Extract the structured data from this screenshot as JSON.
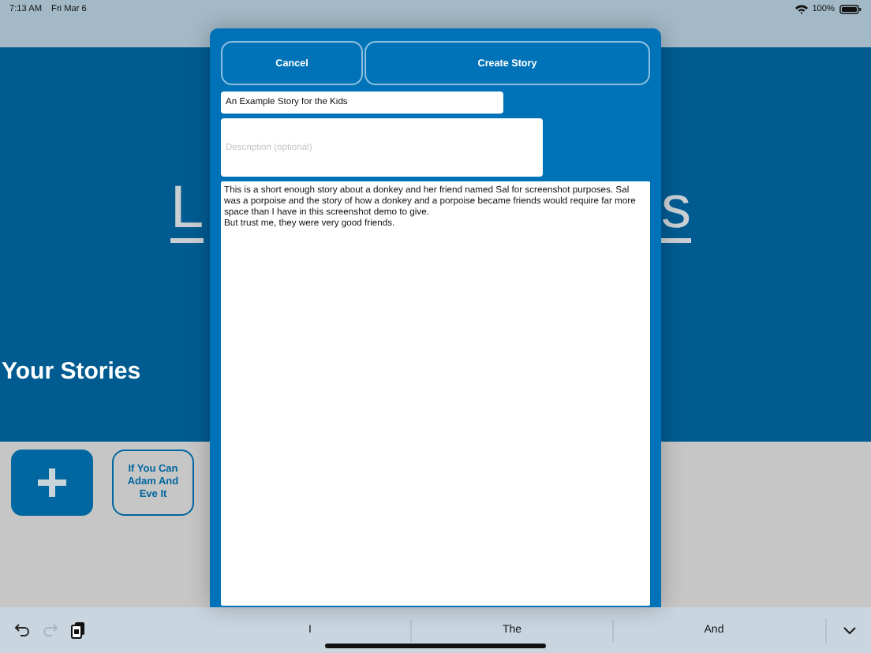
{
  "status_bar": {
    "time": "7:13 AM",
    "date": "Fri Mar 6",
    "battery": "100%"
  },
  "background": {
    "heading_left": "L",
    "heading_right": "s",
    "section_title": "Your Stories",
    "stories": [
      {
        "title": "If You Can Adam And Eve It"
      }
    ]
  },
  "dialog": {
    "buttons": [
      {
        "label": "Cancel"
      },
      {
        "label": "Create Story"
      }
    ],
    "title_field": {
      "value": "An Example Story for the Kids"
    },
    "description_field": {
      "placeholder": "Description (optional)"
    },
    "story_field": {
      "value": "This is a short enough story about a donkey and her friend named Sal for screenshot purposes. Sal was a porpoise and the story of how a donkey and a porpoise became friends would require far more space than I have in this screenshot demo to give.\nBut trust me, they were very good friends."
    }
  },
  "keyboard_bar": {
    "undo_disabled": false,
    "redo_disabled": true,
    "suggestions": [
      "I",
      "The",
      "And"
    ]
  }
}
